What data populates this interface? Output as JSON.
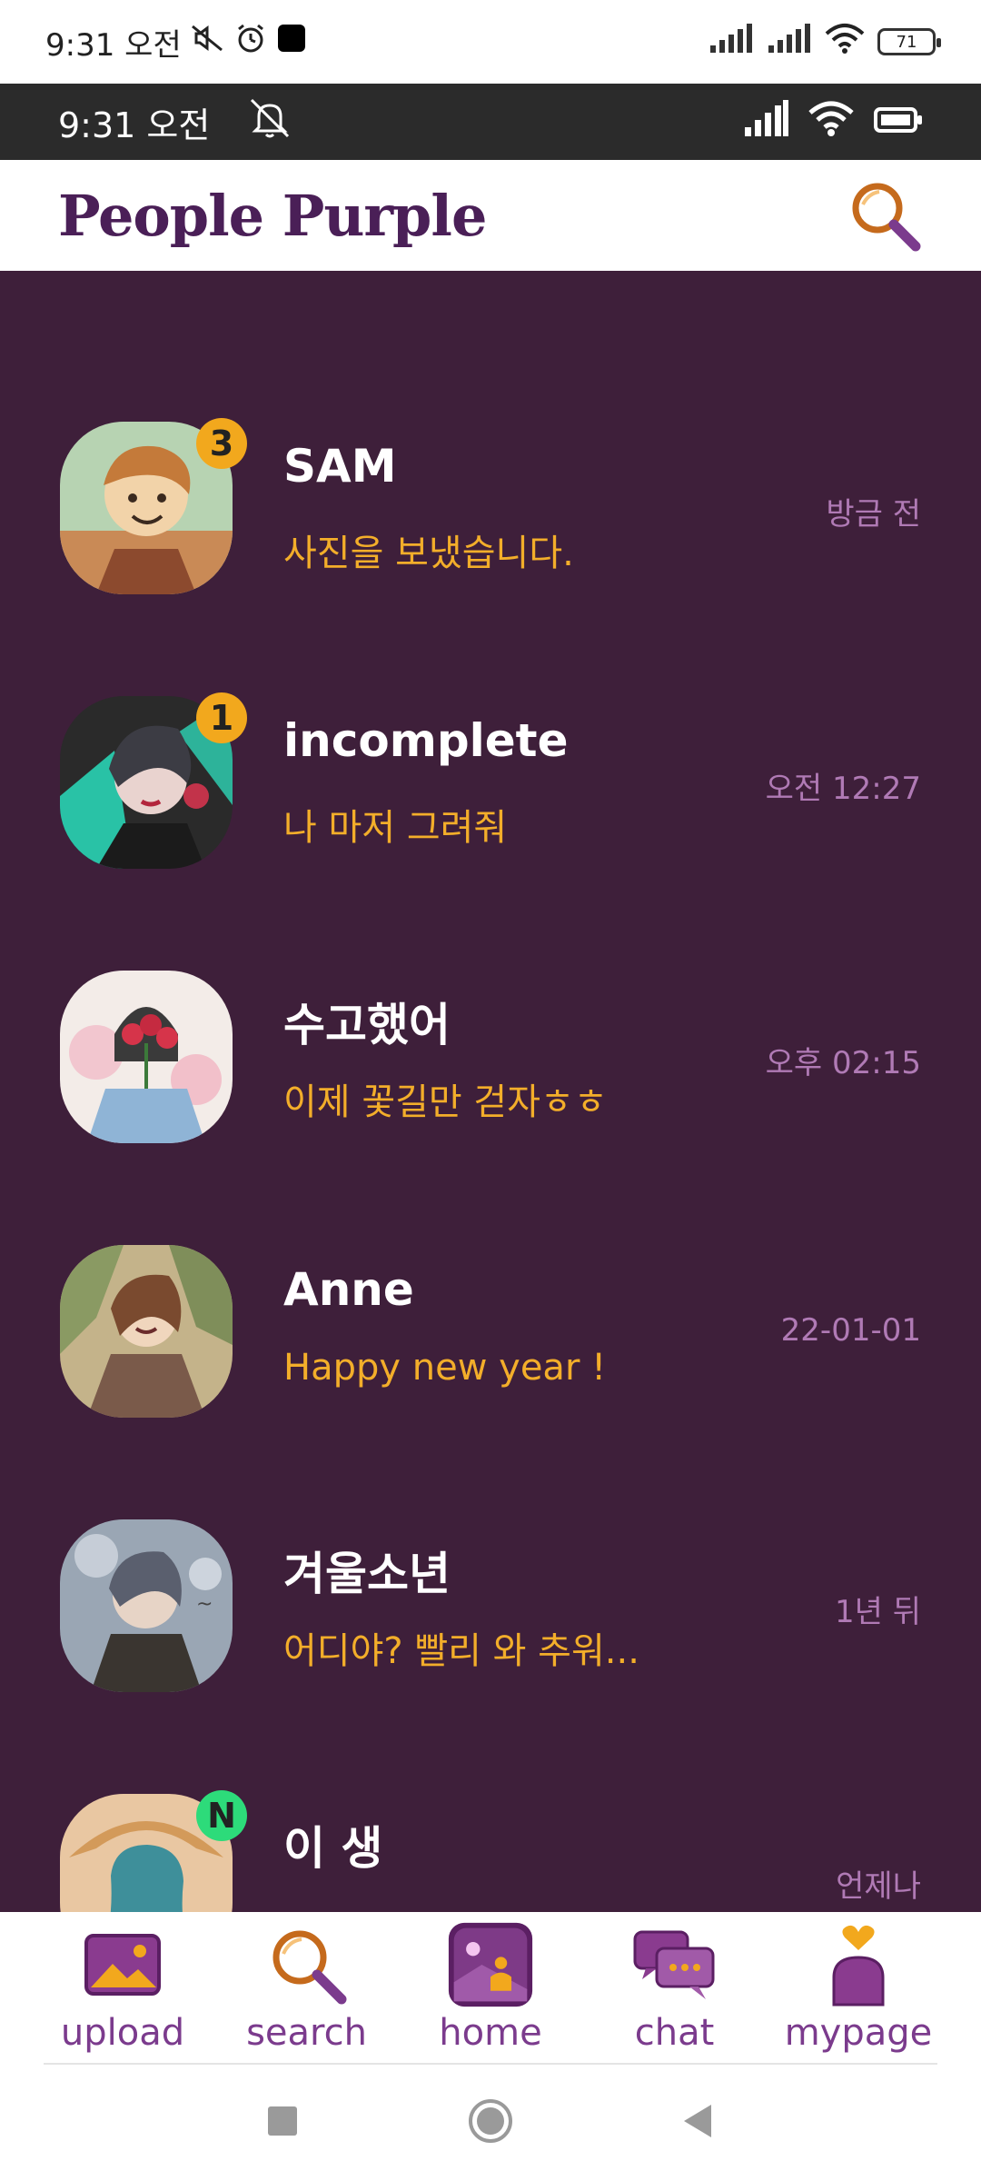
{
  "system_status": {
    "time": "9:31 오전",
    "battery": "71"
  },
  "app_status": {
    "time": "9:31 오전"
  },
  "header": {
    "logo": "People Purple",
    "search_icon": "search-icon"
  },
  "chats": [
    {
      "name": "SAM",
      "message": "사진을 보냈습니다.",
      "time": "방금 전",
      "badge": "3",
      "badge_color": "#f2a81d"
    },
    {
      "name": "incomplete",
      "message": "나 마저 그려줘",
      "time": "오전 12:27",
      "badge": "1",
      "badge_color": "#f2a81d"
    },
    {
      "name": "수고했어",
      "message": "이제 꽃길만 걷자ㅎㅎ",
      "time": "오후 02:15"
    },
    {
      "name": "Anne",
      "message": "Happy new year !",
      "time": "22-01-01"
    },
    {
      "name": "겨울소년",
      "message": "어디야? 빨리 와 추워...",
      "time": "1년 뒤"
    },
    {
      "name": "이 생",
      "message": "",
      "time": "언제나",
      "badge": "N",
      "badge_color": "#2ddb7a"
    }
  ],
  "bottom_nav": {
    "items": [
      {
        "label": "upload",
        "icon": "image-icon"
      },
      {
        "label": "search",
        "icon": "search-icon"
      },
      {
        "label": "home",
        "icon": "home-gallery-icon",
        "active": true
      },
      {
        "label": "chat",
        "icon": "chat-bubbles-icon"
      },
      {
        "label": "mypage",
        "icon": "person-heart-icon"
      }
    ]
  },
  "colors": {
    "brand_purple": "#4a1f57",
    "list_background": "#3e1f3a",
    "accent_orange": "#f3ae2a",
    "time_text": "#b07ab5",
    "nav_label": "#7b3b8d"
  }
}
